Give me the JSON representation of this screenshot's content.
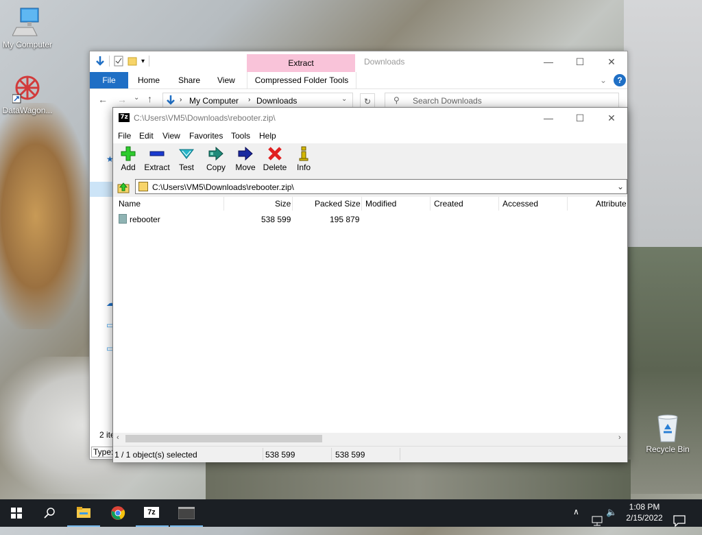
{
  "desktop": {
    "icons": [
      {
        "label": "My Computer"
      },
      {
        "label": "DataWagon..."
      },
      {
        "label": "Recycle Bin"
      }
    ]
  },
  "explorer": {
    "context_tab_header": "Extract",
    "title": "Downloads",
    "ribbon_tabs": {
      "file": "File",
      "home": "Home",
      "share": "Share",
      "view": "View",
      "compressed": "Compressed Folder Tools"
    },
    "breadcrumb": [
      "My Computer",
      "Downloads"
    ],
    "search_placeholder": "Search Downloads",
    "status_items": "2 ite",
    "status_type": "Type:"
  },
  "sevenzip": {
    "title": "C:\\Users\\VM5\\Downloads\\rebooter.zip\\",
    "app_icon": "7z",
    "menu": [
      "File",
      "Edit",
      "View",
      "Favorites",
      "Tools",
      "Help"
    ],
    "toolbar": [
      {
        "label": "Add",
        "icon": "plus-icon",
        "color": "#2ecc2e"
      },
      {
        "label": "Extract",
        "icon": "minus-icon",
        "color": "#1a3ad0"
      },
      {
        "label": "Test",
        "icon": "check-icon",
        "color": "#27b5c8"
      },
      {
        "label": "Copy",
        "icon": "copy-arrow-icon",
        "color": "#1f8a7a"
      },
      {
        "label": "Move",
        "icon": "move-arrow-icon",
        "color": "#1a2aa0"
      },
      {
        "label": "Delete",
        "icon": "x-icon",
        "color": "#e02020"
      },
      {
        "label": "Info",
        "icon": "info-icon",
        "color": "#d4b800"
      }
    ],
    "address": "C:\\Users\\VM5\\Downloads\\rebooter.zip\\",
    "columns": [
      "Name",
      "Size",
      "Packed Size",
      "Modified",
      "Created",
      "Accessed",
      "Attribute"
    ],
    "rows": [
      {
        "name": "rebooter",
        "size": "538 599",
        "packed": "195 879"
      }
    ],
    "status": {
      "selection": "1 / 1 object(s) selected",
      "size": "538 599",
      "packed": "538 599"
    }
  },
  "taskbar": {
    "time": "1:08 PM",
    "date": "2/15/2022",
    "apps": [
      "start-icon",
      "search-icon",
      "file-explorer-icon",
      "chrome-icon",
      "7zip-icon",
      "terminal-icon"
    ],
    "seven_zip_label": "7z"
  }
}
